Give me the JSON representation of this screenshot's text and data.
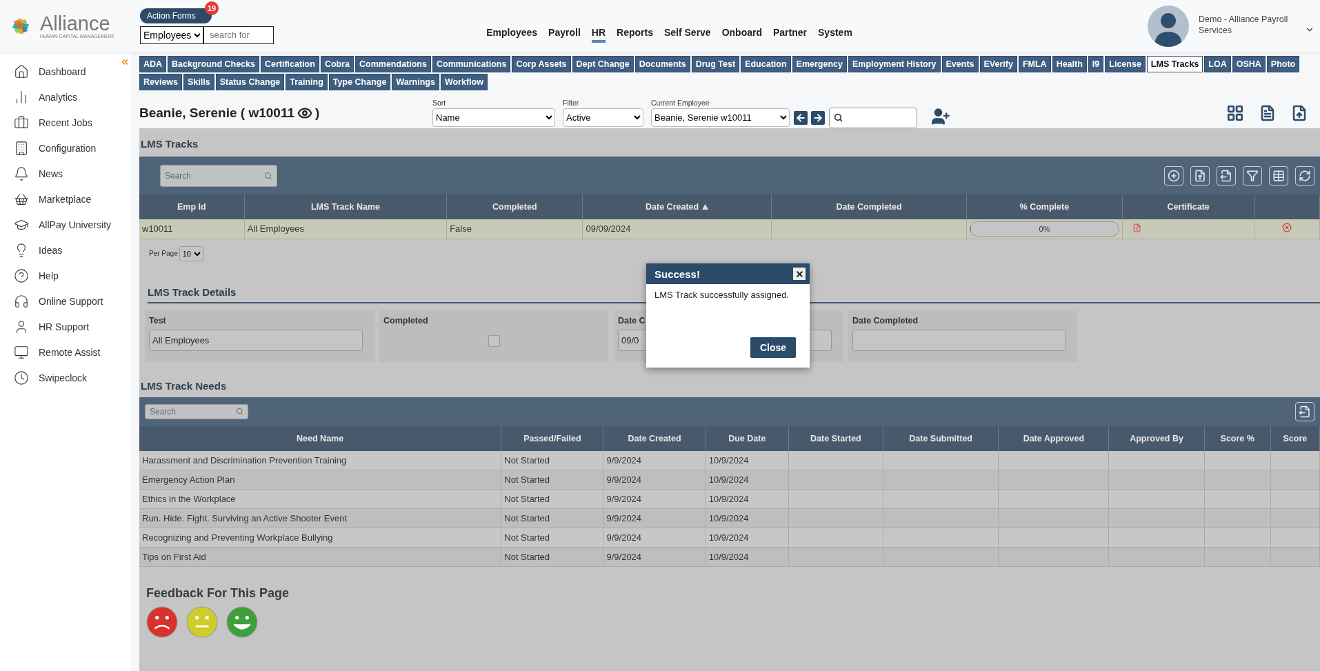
{
  "logo": {
    "name": "Alliance",
    "tagline": "HUMAN CAPITAL MANAGEMENT"
  },
  "action_forms": {
    "label": "Action Forms",
    "badge": "19"
  },
  "quick_search": {
    "category": "Employees",
    "placeholder": "search for"
  },
  "nav": [
    {
      "label": "Employees",
      "selected": false
    },
    {
      "label": "Payroll",
      "selected": false
    },
    {
      "label": "HR",
      "selected": true
    },
    {
      "label": "Reports",
      "selected": false
    },
    {
      "label": "Self Serve",
      "selected": false
    },
    {
      "label": "Onboard",
      "selected": false
    },
    {
      "label": "Partner",
      "selected": false
    },
    {
      "label": "System",
      "selected": false
    }
  ],
  "user": {
    "name": "Demo - Alliance Payroll Services"
  },
  "sidebar": {
    "items": [
      {
        "label": "Dashboard"
      },
      {
        "label": "Analytics"
      },
      {
        "label": "Recent Jobs"
      },
      {
        "label": "Configuration"
      },
      {
        "label": "News"
      },
      {
        "label": "Marketplace"
      },
      {
        "label": "AllPay University"
      },
      {
        "label": "Ideas"
      },
      {
        "label": "Help"
      },
      {
        "label": "Online Support"
      },
      {
        "label": "HR Support"
      },
      {
        "label": "Remote Assist"
      },
      {
        "label": "Swipeclock"
      }
    ]
  },
  "tab_rows": [
    [
      {
        "label": "ADA",
        "selected": false
      },
      {
        "label": "Background Checks",
        "selected": false
      },
      {
        "label": "Certification",
        "selected": false
      },
      {
        "label": "Cobra",
        "selected": false
      },
      {
        "label": "Commendations",
        "selected": false
      },
      {
        "label": "Communications",
        "selected": false
      },
      {
        "label": "Corp Assets",
        "selected": false
      },
      {
        "label": "Dept Change",
        "selected": false
      },
      {
        "label": "Documents",
        "selected": false
      },
      {
        "label": "Drug Test",
        "selected": false
      },
      {
        "label": "Education",
        "selected": false
      },
      {
        "label": "Emergency",
        "selected": false
      },
      {
        "label": "Employment History",
        "selected": false
      },
      {
        "label": "Events",
        "selected": false
      },
      {
        "label": "EVerify",
        "selected": false
      },
      {
        "label": "FMLA",
        "selected": false
      },
      {
        "label": "Health",
        "selected": false
      },
      {
        "label": "I9",
        "selected": false
      },
      {
        "label": "License",
        "selected": false
      },
      {
        "label": "LMS Tracks",
        "selected": true
      },
      {
        "label": "LOA",
        "selected": false
      },
      {
        "label": "OSHA",
        "selected": false
      },
      {
        "label": "Photo",
        "selected": false
      }
    ],
    [
      {
        "label": "Reviews",
        "selected": false
      },
      {
        "label": "Skills",
        "selected": false
      },
      {
        "label": "Status Change",
        "selected": false
      },
      {
        "label": "Training",
        "selected": false
      },
      {
        "label": "Type Change",
        "selected": false
      },
      {
        "label": "Warnings",
        "selected": false
      },
      {
        "label": "Workflow",
        "selected": false
      }
    ]
  ],
  "employee": {
    "title_start": "Beanie, Serenie ( w10011",
    "title_end": ")"
  },
  "filters": [
    {
      "label": "Sort",
      "value": "Name"
    },
    {
      "label": "Filter",
      "value": "Active"
    },
    {
      "label": "Current Employee",
      "value": "Beanie, Serenie w10011"
    }
  ],
  "lms_tracks": {
    "title": "LMS Tracks",
    "search_placeholder": "Search",
    "columns": [
      {
        "label": "Emp Id",
        "sorted": false
      },
      {
        "label": "LMS Track Name",
        "sorted": false
      },
      {
        "label": "Completed",
        "sorted": false
      },
      {
        "label": "Date Created",
        "sorted": true
      },
      {
        "label": "Date Completed",
        "sorted": false
      },
      {
        "label": "% Complete",
        "sorted": false
      },
      {
        "label": "Certificate",
        "sorted": false
      }
    ],
    "rows": [
      {
        "emp_id": "w10011",
        "track_name": "All Employees",
        "completed": "False",
        "date_created": "09/09/2024",
        "percent": "0%",
        "level": 0
      }
    ],
    "per_page": {
      "label": "Per Page",
      "value": "10"
    }
  },
  "details": {
    "title": "LMS Track Details",
    "fields": [
      {
        "kind": "text",
        "label": "Test",
        "value": "All Employees"
      },
      {
        "kind": "checkbox",
        "label": "Completed",
        "checked": false
      },
      {
        "kind": "text",
        "label": "Date C",
        "value": "09/0"
      },
      {
        "kind": "text",
        "label": "Date Completed"
      }
    ]
  },
  "needs": {
    "title": "LMS Track Needs",
    "search_placeholder": "Search",
    "columns": [
      "Need Name",
      "Passed/Failed",
      "Date Created",
      "Due Date",
      "Date Started",
      "Date Submitted",
      "Date Approved",
      "Approved By",
      "Score %",
      "Score"
    ],
    "rows": [
      {
        "name": "Harassment and Discrimination Prevention Training",
        "status": "Not Started",
        "created": "9/9/2024",
        "due": "10/9/2024"
      },
      {
        "name": "Emergency Action Plan",
        "status": "Not Started",
        "created": "9/9/2024",
        "due": "10/9/2024"
      },
      {
        "name": "Ethics in the Workplace",
        "status": "Not Started",
        "created": "9/9/2024",
        "due": "10/9/2024"
      },
      {
        "name": "Run. Hide. Fight. Surviving an Active Shooter Event",
        "status": "Not Started",
        "created": "9/9/2024",
        "due": "10/9/2024"
      },
      {
        "name": "Recognizing and Preventing Workplace Bullying",
        "status": "Not Started",
        "created": "9/9/2024",
        "due": "10/9/2024"
      },
      {
        "name": "Tips on First Aid",
        "status": "Not Started",
        "created": "9/9/2024",
        "due": "10/9/2024"
      }
    ]
  },
  "feedback": {
    "title": "Feedback For This Page"
  },
  "modal": {
    "title": "Success!",
    "message": "LMS Track successfully assigned.",
    "button": "Close"
  }
}
